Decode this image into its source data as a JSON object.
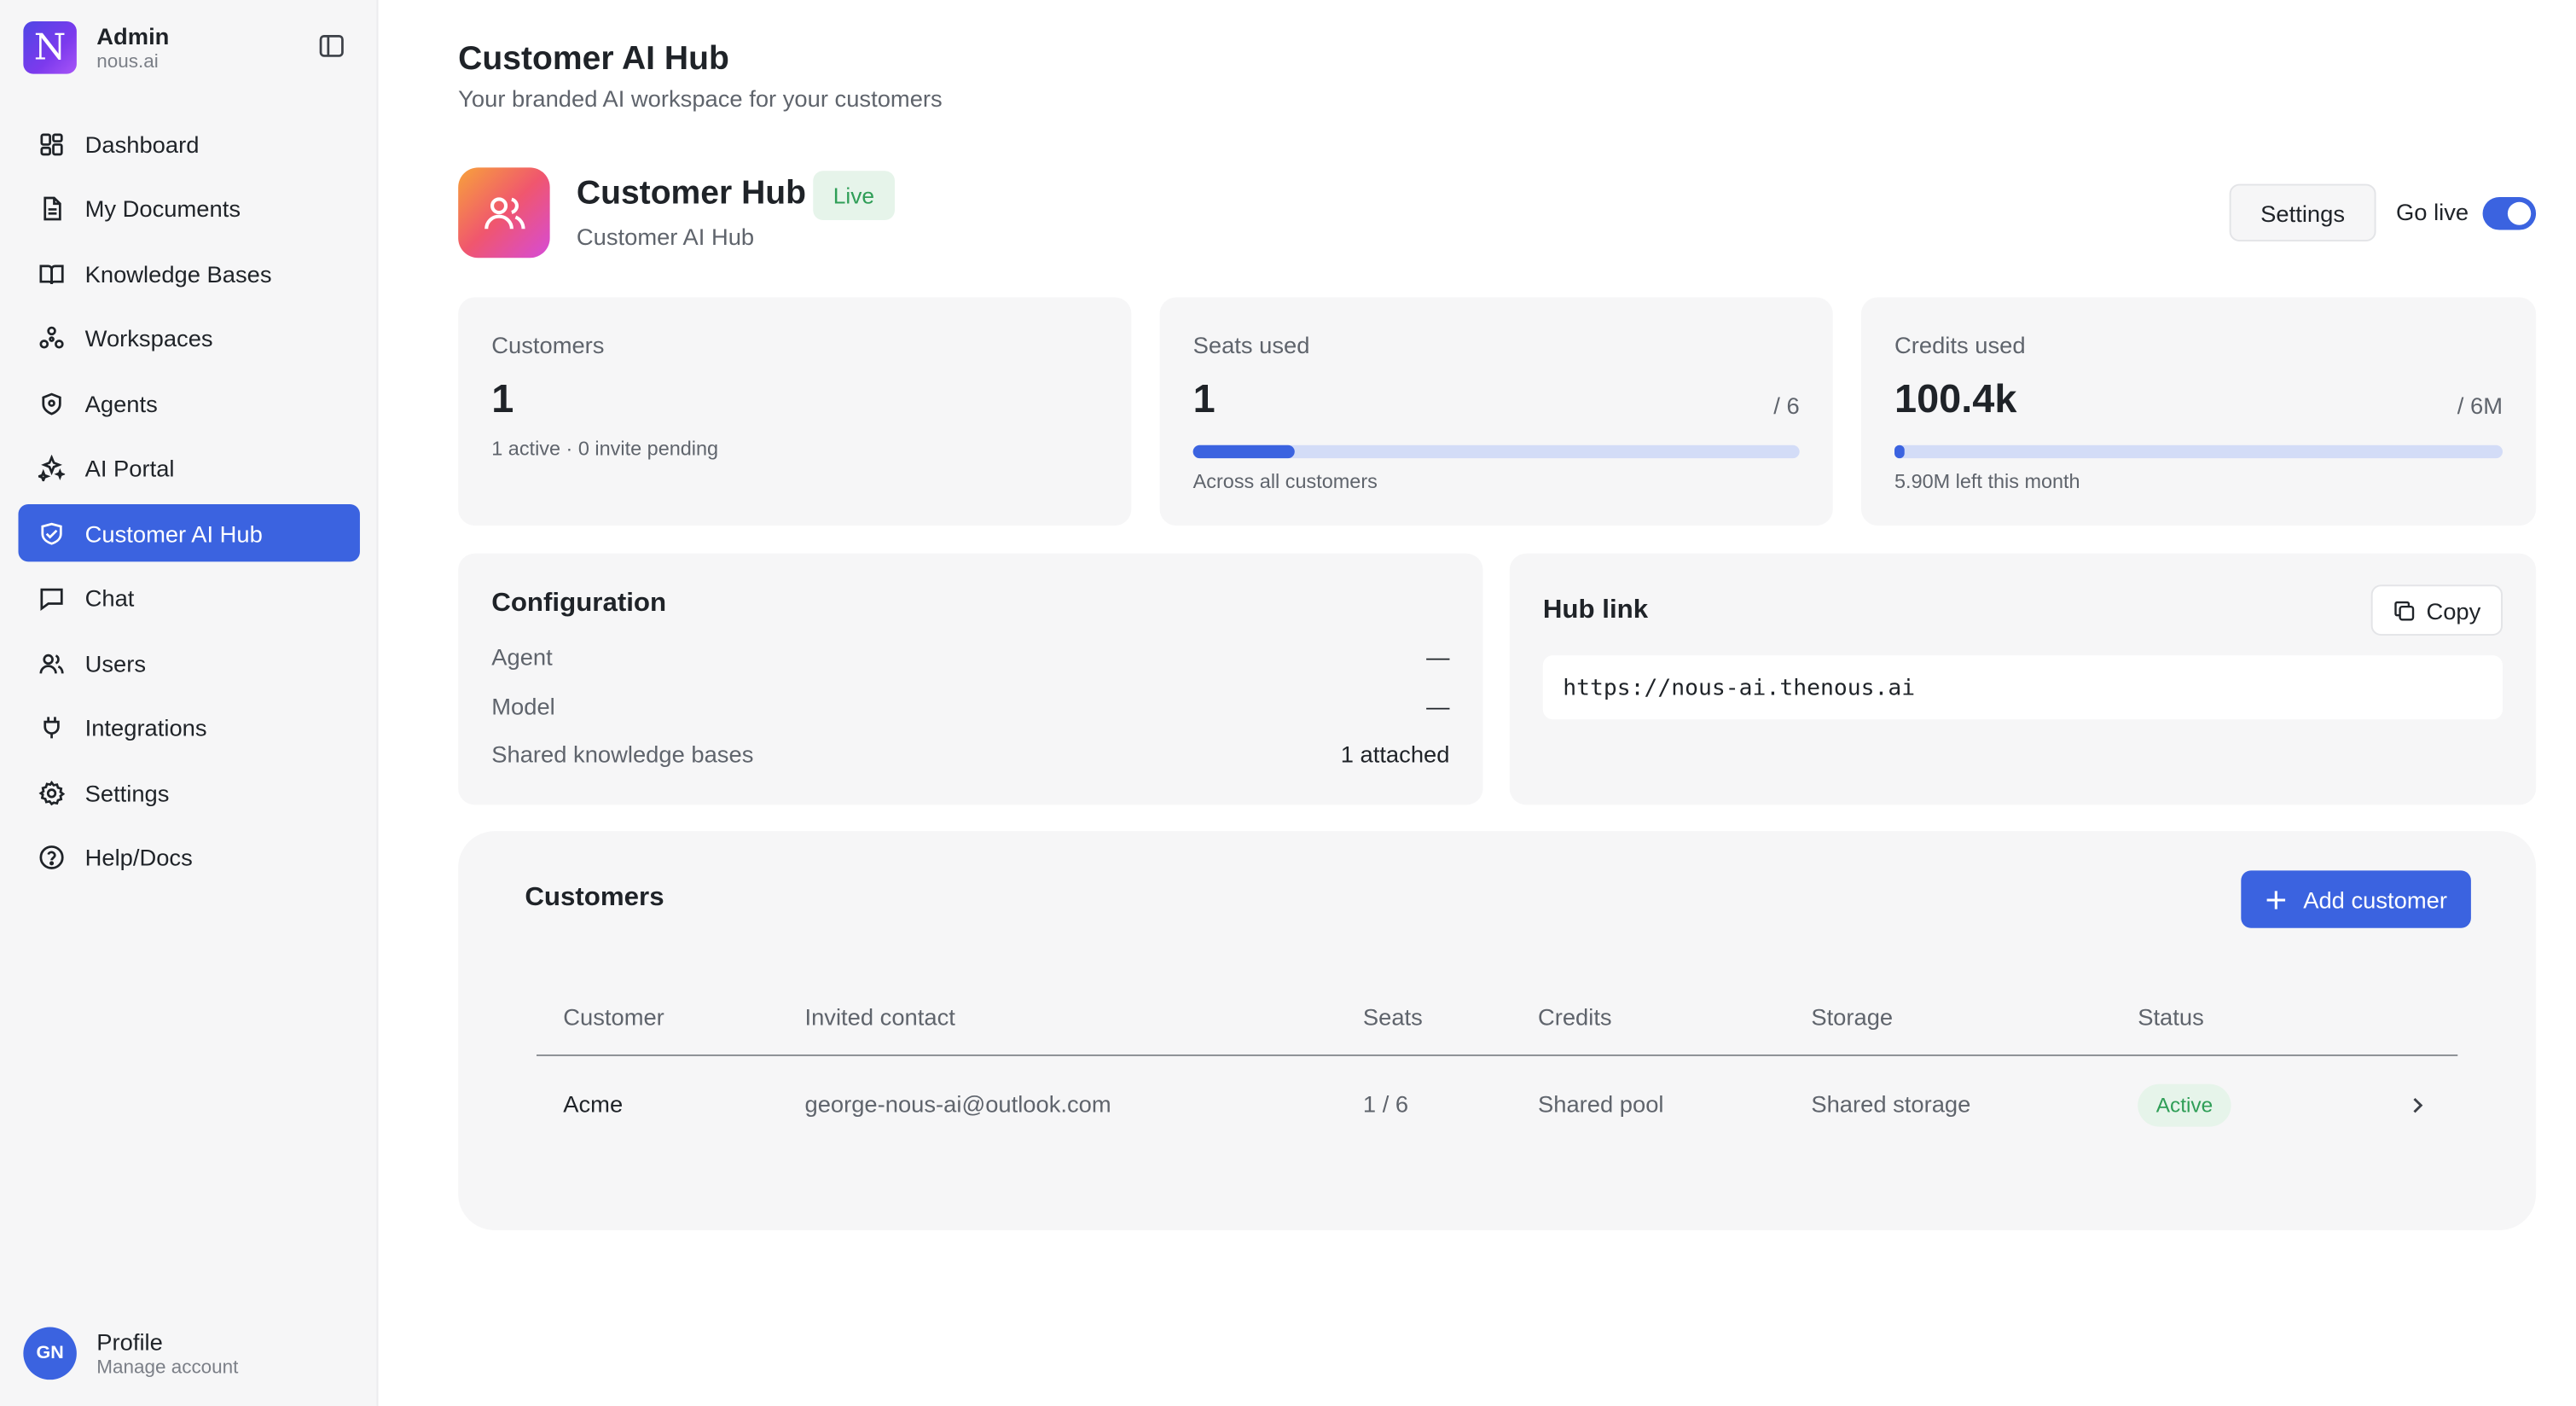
{
  "brand": {
    "logo_letter": "N",
    "title": "Admin",
    "subtitle": "nous.ai"
  },
  "sidebar": {
    "items": [
      {
        "label": "Dashboard",
        "icon": "dashboard-icon"
      },
      {
        "label": "My Documents",
        "icon": "document-icon"
      },
      {
        "label": "Knowledge Bases",
        "icon": "book-icon"
      },
      {
        "label": "Workspaces",
        "icon": "workspaces-icon"
      },
      {
        "label": "Agents",
        "icon": "agent-icon"
      },
      {
        "label": "AI Portal",
        "icon": "sparkles-icon"
      },
      {
        "label": "Customer AI Hub",
        "icon": "handshake-icon",
        "active": true
      },
      {
        "label": "Chat",
        "icon": "chat-icon"
      },
      {
        "label": "Users",
        "icon": "users-icon"
      },
      {
        "label": "Integrations",
        "icon": "plug-icon"
      },
      {
        "label": "Settings",
        "icon": "gear-icon"
      },
      {
        "label": "Help/Docs",
        "icon": "help-icon"
      }
    ]
  },
  "profile": {
    "initials": "GN",
    "title": "Profile",
    "subtitle": "Manage account"
  },
  "page": {
    "title": "Customer AI Hub",
    "subtitle": "Your branded AI workspace for your customers"
  },
  "hub": {
    "name": "Customer Hub",
    "badge": "Live",
    "subtitle": "Customer AI Hub",
    "settings_label": "Settings",
    "go_live_label": "Go live",
    "go_live_on": true
  },
  "stats": {
    "customers": {
      "label": "Customers",
      "value": "1",
      "footer": "1 active · 0 invite pending"
    },
    "seats": {
      "label": "Seats used",
      "value": "1",
      "denominator": "/ 6",
      "progress": 0.167,
      "footer": "Across all customers"
    },
    "credits": {
      "label": "Credits used",
      "value": "100.4k",
      "denominator": "/ 6M",
      "progress": 0.017,
      "footer": "5.90M left this month"
    }
  },
  "configuration": {
    "title": "Configuration",
    "rows": [
      {
        "key": "Agent",
        "value": "—"
      },
      {
        "key": "Model",
        "value": "—"
      },
      {
        "key": "Shared knowledge bases",
        "value": "1 attached"
      }
    ]
  },
  "hub_link": {
    "title": "Hub link",
    "copy_label": "Copy",
    "url": "https://nous-ai.thenous.ai"
  },
  "customers": {
    "title": "Customers",
    "add_label": "Add customer",
    "columns": [
      "Customer",
      "Invited contact",
      "Seats",
      "Credits",
      "Storage",
      "Status"
    ],
    "rows": [
      {
        "customer": "Acme",
        "contact": "george-nous-ai@outlook.com",
        "seats": "1 / 6",
        "credits": "Shared pool",
        "storage": "Shared storage",
        "status": "Active"
      }
    ]
  },
  "colors": {
    "accent": "#3b63e0",
    "live_green": "#2f9e57",
    "live_bg": "#e6f4ea",
    "card_bg": "#f6f6f7"
  }
}
